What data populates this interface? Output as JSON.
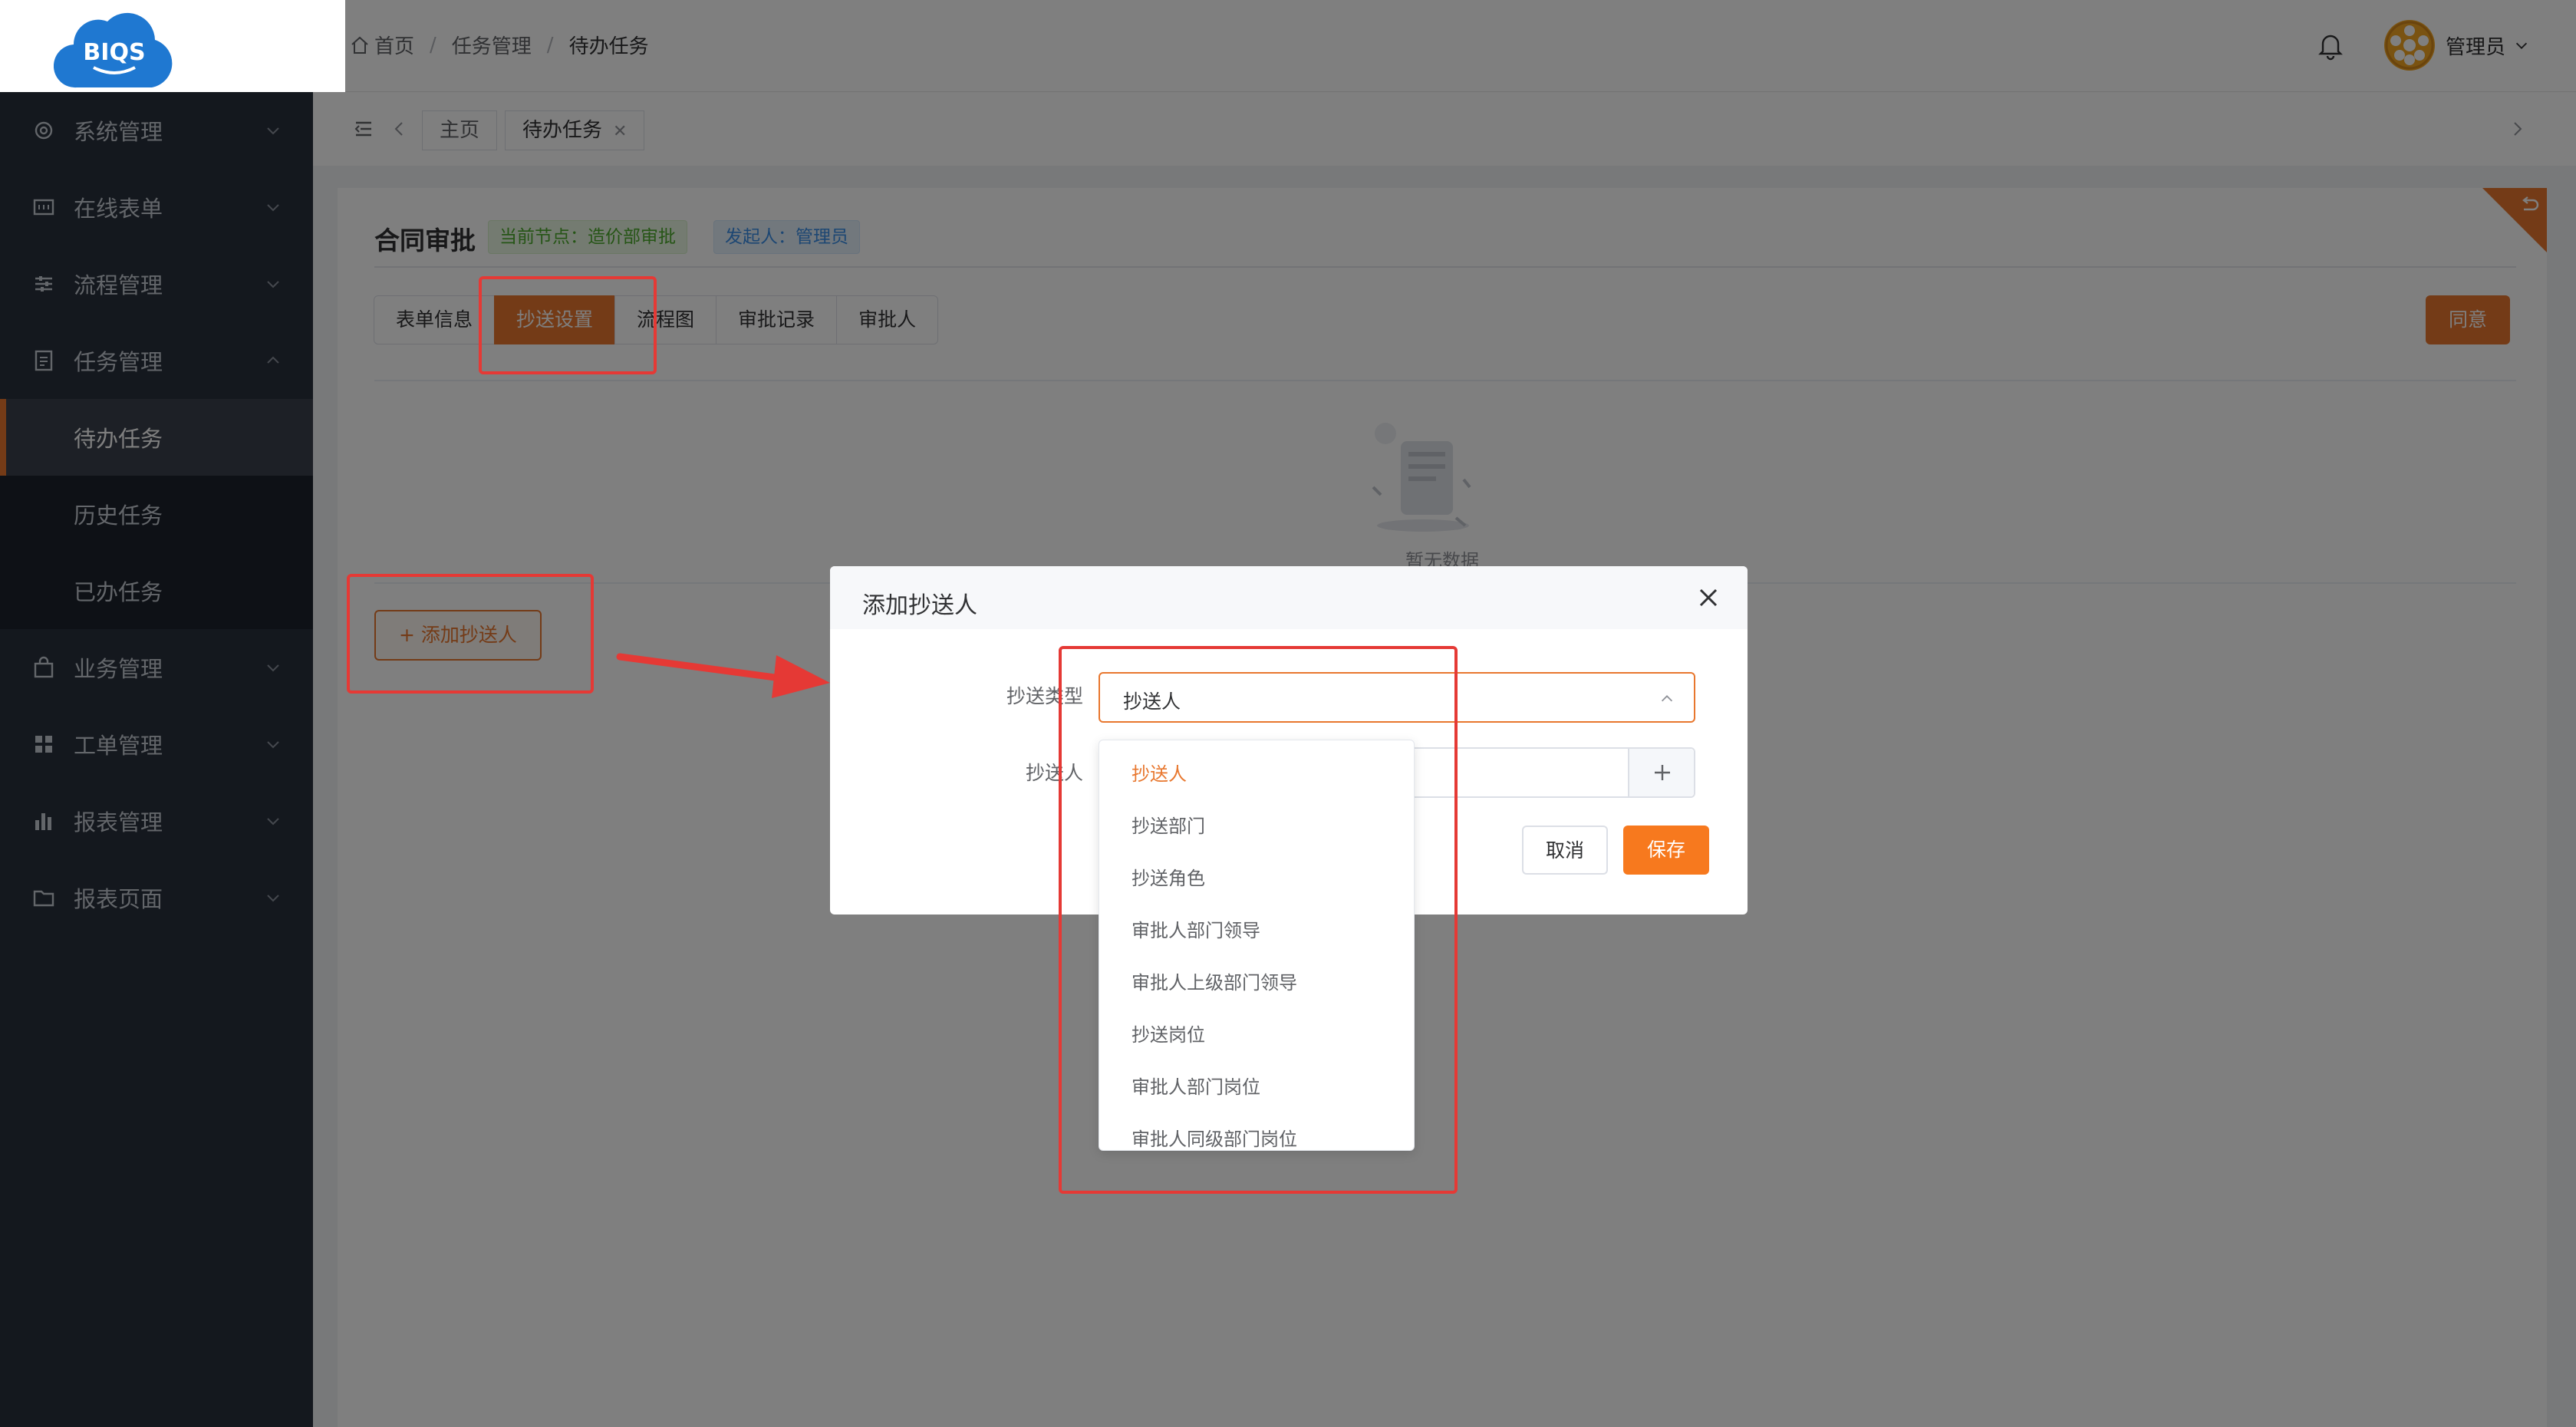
{
  "logo": {
    "text": "BIQS"
  },
  "sidebar": {
    "items": [
      {
        "label": "系统管理",
        "icon": "gear-icon"
      },
      {
        "label": "在线表单",
        "icon": "form-icon"
      },
      {
        "label": "流程管理",
        "icon": "sliders-icon"
      },
      {
        "label": "任务管理",
        "icon": "doc-icon",
        "expanded": true,
        "children": [
          {
            "label": "待办任务",
            "active": true
          },
          {
            "label": "历史任务"
          },
          {
            "label": "已办任务"
          }
        ]
      },
      {
        "label": "业务管理",
        "icon": "bag-icon"
      },
      {
        "label": "工单管理",
        "icon": "grid-icon"
      },
      {
        "label": "报表管理",
        "icon": "bar-chart-icon"
      },
      {
        "label": "报表页面",
        "icon": "folder-icon"
      }
    ]
  },
  "header": {
    "breadcrumb": [
      "首页",
      "任务管理",
      "待办任务"
    ],
    "user": "管理员"
  },
  "page_tabs": [
    {
      "label": "主页"
    },
    {
      "label": "待办任务",
      "closable": true
    }
  ],
  "card": {
    "title": "合同审批",
    "node_tag": "当前节点：造价部审批",
    "initiator_tag": "发起人：管理员",
    "tabs": [
      {
        "label": "表单信息"
      },
      {
        "label": "抄送设置",
        "active": true
      },
      {
        "label": "流程图"
      },
      {
        "label": "审批记录"
      },
      {
        "label": "审批人"
      }
    ],
    "agree_label": "同意",
    "empty_text": "暂无数据",
    "add_label": "+ 添加抄送人"
  },
  "dialog": {
    "title": "添加抄送人",
    "type_label": "抄送类型",
    "type_value": "抄送人",
    "person_label": "抄送人",
    "cancel_label": "取消",
    "save_label": "保存",
    "options": [
      "抄送人",
      "抄送部门",
      "抄送角色",
      "审批人部门领导",
      "审批人上级部门领导",
      "抄送岗位",
      "审批人部门岗位",
      "审批人同级部门岗位"
    ]
  },
  "colors": {
    "accent": "#e8772e",
    "sidebar_bg": "#28303d",
    "annotation_red": "#e53935"
  }
}
